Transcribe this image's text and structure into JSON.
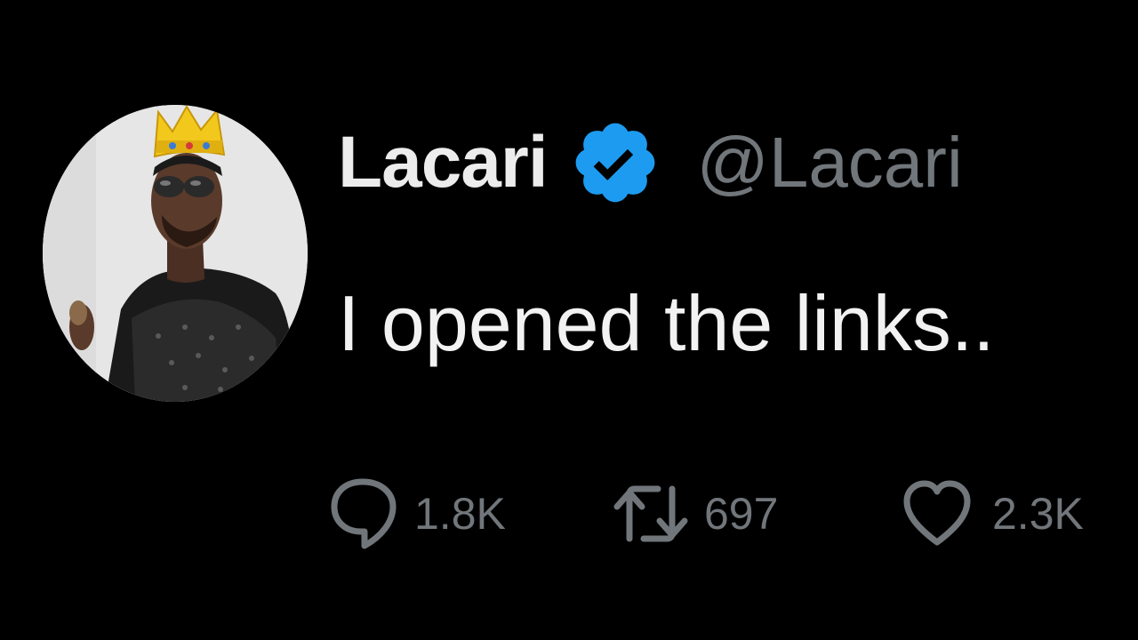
{
  "tweet": {
    "display_name": "Lacari",
    "handle": "@Lacari",
    "text": "I opened the links..",
    "verified": true,
    "colors": {
      "background": "#000000",
      "name": "#ececec",
      "handle": "#71767b",
      "verified_badge": "#1d9bf0"
    }
  },
  "actions": {
    "replies": {
      "icon": "reply-icon",
      "count": "1.8K"
    },
    "retweets": {
      "icon": "retweet-icon",
      "count": "697"
    },
    "likes": {
      "icon": "heart-icon",
      "count": "2.3K"
    }
  }
}
